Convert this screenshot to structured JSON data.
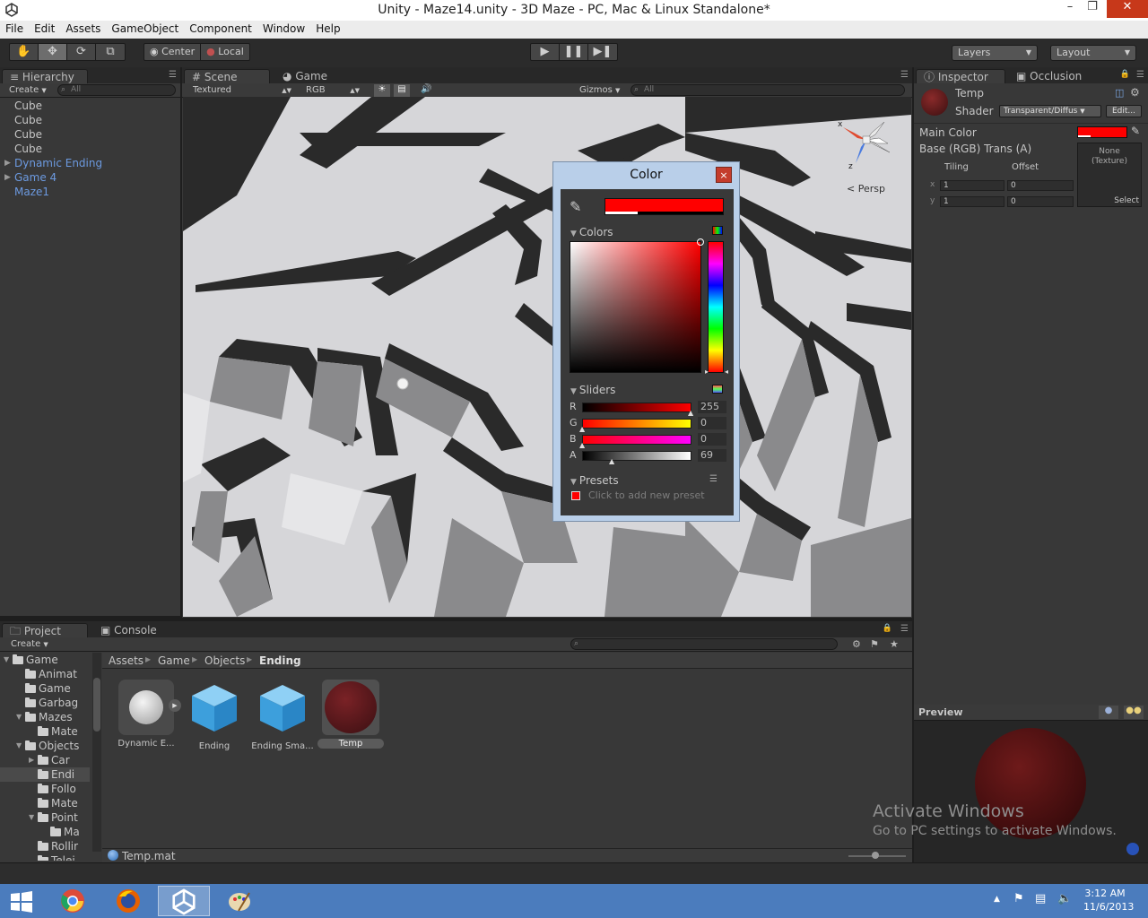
{
  "window": {
    "title": "Unity - Maze14.unity - 3D Maze - PC, Mac & Linux Standalone*"
  },
  "menu": [
    "File",
    "Edit",
    "Assets",
    "GameObject",
    "Component",
    "Window",
    "Help"
  ],
  "toolbar": {
    "pivot": "Center",
    "space": "Local",
    "layers": "Layers",
    "layout": "Layout"
  },
  "hierarchy": {
    "tab": "Hierarchy",
    "create": "Create",
    "search_placeholder": "All",
    "items": [
      {
        "label": "Cube",
        "prefab": false,
        "expandable": false
      },
      {
        "label": "Cube",
        "prefab": false,
        "expandable": false
      },
      {
        "label": "Cube",
        "prefab": false,
        "expandable": false
      },
      {
        "label": "Cube",
        "prefab": false,
        "expandable": false
      },
      {
        "label": "Dynamic Ending",
        "prefab": true,
        "expandable": true
      },
      {
        "label": "Game 4",
        "prefab": true,
        "expandable": true
      },
      {
        "label": "Maze1",
        "prefab": true,
        "expandable": false
      }
    ]
  },
  "scene": {
    "tab_scene": "Scene",
    "tab_game": "Game",
    "render_mode": "Textured",
    "color_mode": "RGB",
    "gizmos": "Gizmos",
    "search_placeholder": "All",
    "projection": "Persp",
    "axis_x": "x",
    "axis_z": "z"
  },
  "color_picker": {
    "title": "Color",
    "close": "×",
    "colors_label": "Colors",
    "sliders_label": "Sliders",
    "presets_label": "Presets",
    "presets_hint": "Click to add new preset",
    "current_color": "#ff0000",
    "channels": [
      {
        "name": "R",
        "value": "255"
      },
      {
        "name": "G",
        "value": "0"
      },
      {
        "name": "B",
        "value": "0"
      },
      {
        "name": "A",
        "value": "69"
      }
    ]
  },
  "inspector": {
    "tab": "Inspector",
    "tab_occlusion": "Occlusion",
    "material_name": "Temp",
    "shader_label": "Shader",
    "shader_value": "Transparent/Diffus",
    "edit_button": "Edit...",
    "main_color_label": "Main Color",
    "main_color": "#ff0000",
    "base_label": "Base (RGB) Trans (A)",
    "tiling_label": "Tiling",
    "offset_label": "Offset",
    "x_label": "x",
    "y_label": "y",
    "tiling_x": "1",
    "tiling_y": "1",
    "offset_x": "0",
    "offset_y": "0",
    "texture_none": "None\n(Texture)",
    "select_button": "Select"
  },
  "preview": {
    "label": "Preview"
  },
  "project": {
    "tab": "Project",
    "tab_console": "Console",
    "create": "Create",
    "breadcrumb": [
      "Assets",
      "Game",
      "Objects",
      "Ending"
    ],
    "tree": [
      {
        "label": "Game",
        "indent": 0,
        "open": true
      },
      {
        "label": "Animat",
        "indent": 1,
        "open": null
      },
      {
        "label": "Game",
        "indent": 1,
        "open": null
      },
      {
        "label": "Garbag",
        "indent": 1,
        "open": null
      },
      {
        "label": "Mazes",
        "indent": 1,
        "open": true
      },
      {
        "label": "Mate",
        "indent": 2,
        "open": null
      },
      {
        "label": "Objects",
        "indent": 1,
        "open": true
      },
      {
        "label": "Car",
        "indent": 2,
        "open": false
      },
      {
        "label": "Endi",
        "indent": 2,
        "open": null,
        "selected": true
      },
      {
        "label": "Follo",
        "indent": 2,
        "open": null
      },
      {
        "label": "Mate",
        "indent": 2,
        "open": null
      },
      {
        "label": "Point",
        "indent": 2,
        "open": true
      },
      {
        "label": "Ma",
        "indent": 3,
        "open": null
      },
      {
        "label": "Rollir",
        "indent": 2,
        "open": null
      },
      {
        "label": "Telei",
        "indent": 2,
        "open": null
      }
    ],
    "assets": [
      {
        "label": "Dynamic E...",
        "kind": "sphere"
      },
      {
        "label": "Ending",
        "kind": "cube"
      },
      {
        "label": "Ending Sma...",
        "kind": "cube"
      },
      {
        "label": "Temp",
        "kind": "material"
      }
    ],
    "status_file": "Temp.mat"
  },
  "watermark": {
    "line1": "Activate Windows",
    "line2": "Go to PC settings to activate Windows."
  },
  "taskbar": {
    "time": "3:12 AM",
    "date": "11/6/2013"
  }
}
